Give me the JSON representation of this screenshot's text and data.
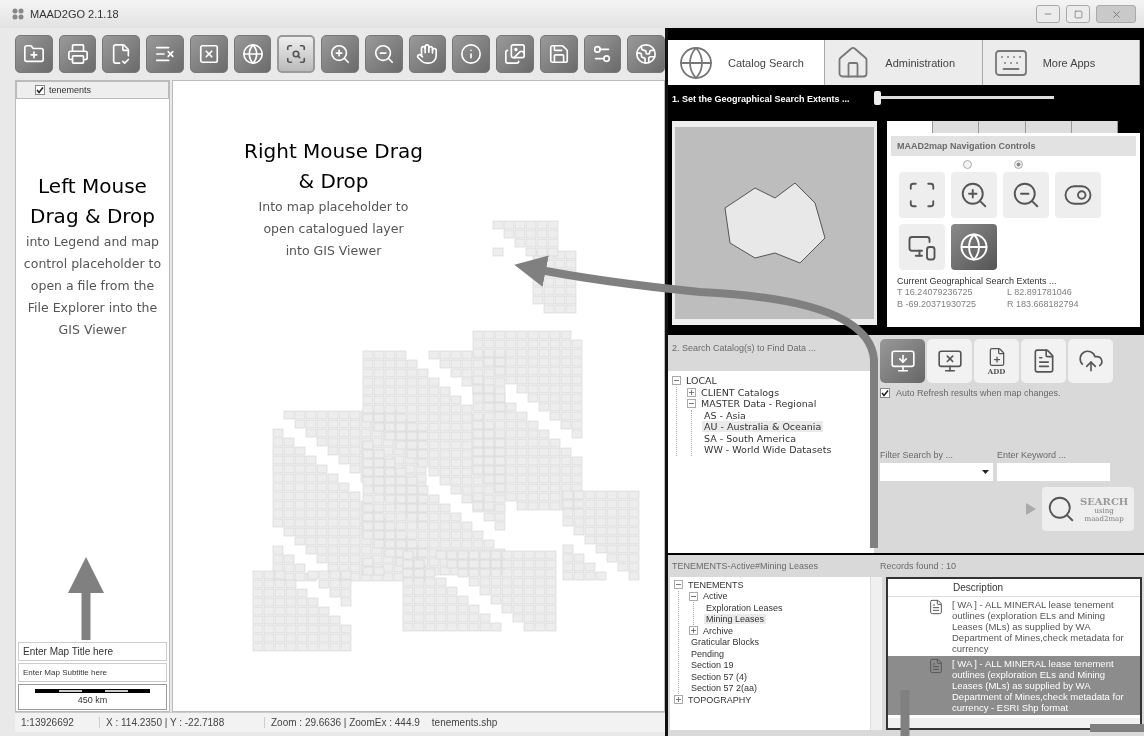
{
  "window": {
    "title": "MAAD2GO 2.1.18"
  },
  "toolbar": [
    {
      "kind": "folder",
      "selected": false
    },
    {
      "kind": "print",
      "selected": false
    },
    {
      "kind": "document",
      "selected": false
    },
    {
      "kind": "clearall",
      "selected": false
    },
    {
      "kind": "remove",
      "selected": false
    },
    {
      "kind": "upload",
      "selected": false
    },
    {
      "kind": "zoombox",
      "selected": true
    },
    {
      "kind": "zoomin",
      "selected": false
    },
    {
      "kind": "zoomout",
      "selected": false
    },
    {
      "kind": "pan",
      "selected": false
    },
    {
      "kind": "info",
      "selected": false
    },
    {
      "kind": "gallery",
      "selected": false
    },
    {
      "kind": "save",
      "selected": false
    },
    {
      "kind": "tools",
      "selected": false
    },
    {
      "kind": "export",
      "selected": false
    }
  ],
  "legend": {
    "layers": [
      {
        "label": "tenements",
        "checked": true
      }
    ],
    "map_title": {
      "placeholder": "Enter Map Title here"
    },
    "map_subtitle": {
      "placeholder": "Enter Map Subtitle here"
    },
    "scale_label": "450 km"
  },
  "annotations": [
    {
      "title": "Left Mouse Drag & Drop",
      "text": "into Legend and map control placeholder to open a file from the File Explorer  into the GIS Viewer"
    },
    {
      "title": "Right Mouse Drag & Drop",
      "text": "Into map placeholder to open catalogued layer into GIS Viewer"
    }
  ],
  "status_bar": [
    "1:13926692",
    "X : 114.2350 | Y : -22.7188",
    "Zoom : 29.6636 | ZoomEx : 444.9",
    "tenements.shp"
  ],
  "tabs": [
    {
      "label": "Catalog Search",
      "selected": true,
      "kind": "globe"
    },
    {
      "label": "Administration",
      "selected": false,
      "kind": "home"
    },
    {
      "label": "More Apps",
      "selected": false,
      "kind": "apps"
    }
  ],
  "extents_section": {
    "title": "1. Set the Geographical Search Extents ...",
    "slider": {
      "level": 0
    },
    "nav_tabs": [
      {
        "selected": true
      },
      {
        "selected": false
      },
      {
        "selected": false
      },
      {
        "selected": false
      },
      {
        "selected": false
      }
    ],
    "nav_title": "MAAD2map Navigation Controls",
    "radios": [
      {
        "selected": false
      },
      {
        "selected": true
      }
    ],
    "nav_buttons": [
      {
        "kind": "zoomfull",
        "selected": false
      },
      {
        "kind": "zoomin",
        "selected": false
      },
      {
        "kind": "zoomout",
        "selected": false
      },
      {
        "kind": "toggle",
        "selected": false
      },
      {
        "kind": "bing",
        "selected": false
      },
      {
        "kind": "globe",
        "selected": true
      }
    ],
    "extents_label": "Current Geographical Search Extents ...",
    "extents": [
      {
        "key": "T",
        "value": "16.24079236725"
      },
      {
        "key": "L",
        "value": "82.891781046"
      },
      {
        "key": "B",
        "value": "-69.20371930725"
      },
      {
        "key": "R",
        "value": "183.668182794"
      }
    ]
  },
  "catalog_section": {
    "title": "2. Search Catalog(s) to Find Data ...",
    "tree": [
      {
        "label": "LOCAL",
        "expanded": true,
        "selected": false,
        "children": [
          {
            "label": "CLIENT Catalogs",
            "expanded": false,
            "selected": false
          },
          {
            "label": "MASTER Data - Regional",
            "expanded": true,
            "selected": false,
            "children": [
              {
                "label": "AS - Asia",
                "selected": false
              },
              {
                "label": "AU - Australia & Oceania",
                "selected": true
              },
              {
                "label": "SA - South America",
                "selected": false
              },
              {
                "label": "WW - World Wide Datasets",
                "selected": false
              }
            ]
          }
        ]
      }
    ],
    "tools": [
      {
        "kind": "import",
        "selected": true
      },
      {
        "kind": "unload",
        "selected": false
      },
      {
        "kind": "add",
        "label": "ADD",
        "selected": false
      },
      {
        "kind": "word",
        "selected": false
      },
      {
        "kind": "cloud",
        "selected": false
      }
    ],
    "auto_refresh": {
      "label": "Auto Refresh results when map changes.",
      "checked": true
    },
    "filter_label": "Filter Search by ...",
    "keyword_label": "Enter Keyword ...",
    "search_button": {
      "label": "SEARCH",
      "caption": "using",
      "caption_2": "maad2map"
    }
  },
  "results_section": {
    "title": "TENEMENTS-Active#Mining Leases",
    "records": "Records found : 10",
    "tree": [
      {
        "label": "TENEMENTS",
        "expanded": true,
        "selected": false,
        "children": [
          {
            "label": "Active",
            "expanded": true,
            "selected": false,
            "children": [
              {
                "label": "Exploration Leases",
                "selected": false
              },
              {
                "label": "Mining Leases",
                "selected": true
              }
            ]
          },
          {
            "label": "Archive",
            "expanded": false,
            "selected": false
          },
          {
            "label": "Graticular Blocks",
            "selected": false
          },
          {
            "label": "Pending",
            "selected": false
          },
          {
            "label": "Section 19",
            "selected": false
          },
          {
            "label": "Section 57 (4)",
            "selected": false
          },
          {
            "label": "Section 57 2(aa)",
            "selected": false
          }
        ]
      },
      {
        "label": "TOPOGRAPHY",
        "expanded": false,
        "selected": false
      }
    ],
    "table": {
      "columns": [
        "Description"
      ],
      "rows": [
        {
          "description": "[ WA ] - ALL MINERAL lease tenement outlines (exploration ELs and Mining Leases (MLs) as supplied by WA Department of Mines,check metadata for currency",
          "selected": false
        },
        {
          "description": "[ WA ] - ALL MINERAL lease tenement outlines (exploration ELs and Mining Leases (MLs) as supplied by WA Department of Mines,check metadata for currency - ESRI Shp format",
          "selected": true
        }
      ]
    }
  }
}
